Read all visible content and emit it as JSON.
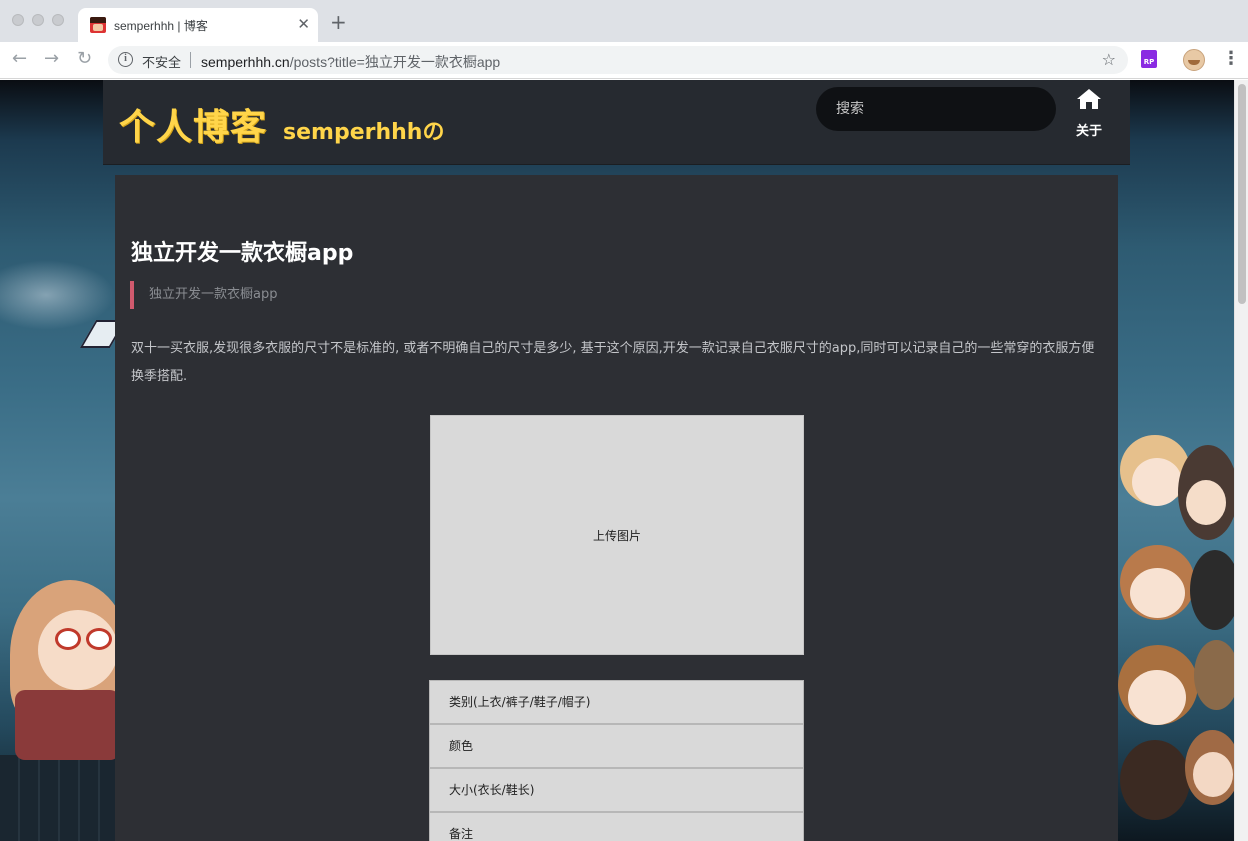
{
  "browser": {
    "tab_title": "semperhhh | 博客",
    "tab_close": "✕",
    "new_tab": "+",
    "security_label": "不安全",
    "url_host": "semperhhh.cn",
    "url_path": "/posts?title=独立开发一款衣橱app",
    "ext_label": "RP"
  },
  "site": {
    "logo_big": "个人博客",
    "logo_small": "semperhhhの",
    "search_placeholder": "搜索",
    "nav_home_label": "关于"
  },
  "post": {
    "title": "独立开发一款衣橱app",
    "quote": "独立开发一款衣橱app",
    "body": "双十一买衣服,发现很多衣服的尺寸不是标准的, 或者不明确自己的尺寸是多少, 基于这个原因,开发一款记录自己衣服尺寸的app,同时可以记录自己的一些常穿的衣服方便换季搭配.",
    "upload_label": "上传图片",
    "fields": [
      "类别(上衣/裤子/鞋子/帽子)",
      "颜色",
      "大小(衣长/鞋长)",
      "备注"
    ]
  },
  "colors": {
    "accent_logo": "#ffd54a",
    "quote_bar": "#d05a6e",
    "header_bg": "#262a30",
    "article_bg": "#2d2f34"
  }
}
